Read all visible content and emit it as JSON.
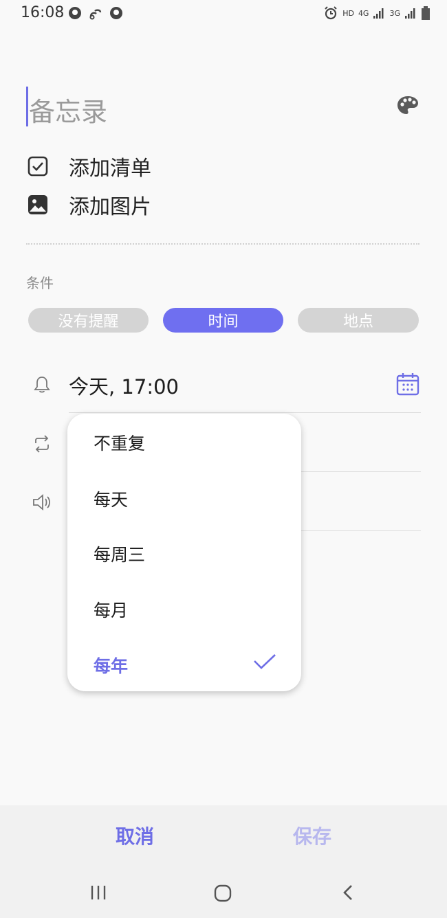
{
  "status_bar": {
    "time": "16:08",
    "right_labels": [
      "HD",
      "4G",
      "3G"
    ]
  },
  "note": {
    "title_placeholder": "备忘录",
    "add_checklist": "添加清单",
    "add_image": "添加图片"
  },
  "condition": {
    "label": "条件",
    "tabs": [
      {
        "label": "没有提醒",
        "selected": false
      },
      {
        "label": "时间",
        "selected": true
      },
      {
        "label": "地点",
        "selected": false
      }
    ]
  },
  "reminder": {
    "time_value": "今天, 17:00"
  },
  "repeat_dropdown": {
    "options": [
      "不重复",
      "每天",
      "每周三",
      "每月",
      "每年"
    ],
    "selected": "每年"
  },
  "footer": {
    "cancel": "取消",
    "save": "保存"
  },
  "colors": {
    "accent": "#6f6ff0",
    "accent_text": "#6e6ee6",
    "disabled_accent": "#b7b7ee",
    "background": "#f9f9f9"
  }
}
